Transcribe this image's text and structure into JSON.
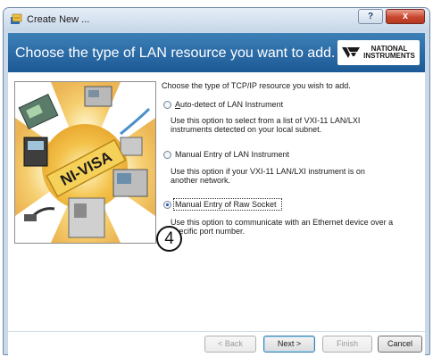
{
  "window": {
    "title": "Create New ...",
    "help_glyph": "?",
    "close_glyph": "x"
  },
  "header": {
    "title": "Choose the type of LAN resource you want to add.",
    "logo_line1": "NATIONAL",
    "logo_line2": "INSTRUMENTS"
  },
  "art": {
    "banner_text": "NI-VISA"
  },
  "content": {
    "intro": "Choose the type of TCP/IP resource you wish to add.",
    "options": [
      {
        "label": "Auto-detect of LAN Instrument",
        "description": "Use this option to select from a list of VXI-11 LAN/LXI instruments detected on your local subnet.",
        "checked": false
      },
      {
        "label": "Manual Entry of LAN Instrument",
        "description": "Use this option if your VXI-11 LAN/LXI instrument is on another network.",
        "checked": false
      },
      {
        "label": "Manual Entry of Raw Socket",
        "description": "Use this option to communicate with an Ethernet device over a specific port number.",
        "checked": true
      }
    ]
  },
  "annotation": {
    "step_number": "4"
  },
  "buttons": {
    "back": "< Back",
    "next": "Next >",
    "finish": "Finish",
    "cancel": "Cancel"
  },
  "colors": {
    "header_band": "#1c5996",
    "window_frame": "#c9d9ea",
    "radio_selected": "#1e4fb8"
  }
}
